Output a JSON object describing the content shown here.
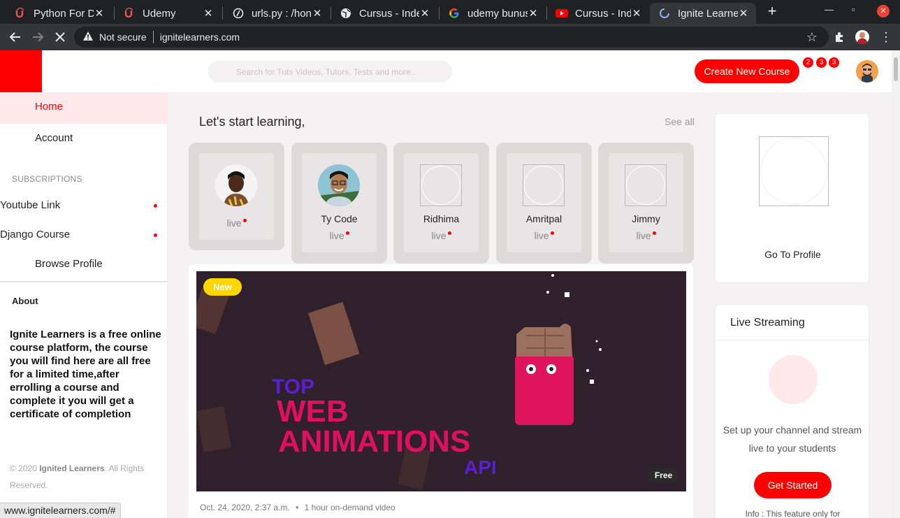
{
  "browser": {
    "tabs": [
      {
        "title": "Python For D",
        "icon": "udemy-icon"
      },
      {
        "title": "Udemy",
        "icon": "udemy-icon"
      },
      {
        "title": "urls.py : /hon",
        "icon": "pythonanywhere-icon"
      },
      {
        "title": "Cursus - Inde",
        "icon": "globe-icon"
      },
      {
        "title": "udemy bunus",
        "icon": "google-icon"
      },
      {
        "title": "Cursus - Inde",
        "icon": "youtube-icon"
      },
      {
        "title": "Ignite Learne",
        "icon": "loading-spinner-icon"
      }
    ],
    "address": {
      "security_label": "Not secure",
      "url": "ignitelearners.com"
    },
    "status_url": "www.ignitelearners.com/#"
  },
  "header": {
    "search_placeholder": "Search for Tuts Videos, Tutors, Tests and more..",
    "create_button": "Create New Course",
    "badges": [
      "2",
      "3",
      "3"
    ]
  },
  "sidebar": {
    "home": "Home",
    "account": "Account",
    "subscriptions_title": "SUBSCRIPTIONS",
    "subscriptions": [
      "Youtube Link",
      "Django Course"
    ],
    "browse_profile": "Browse Profile",
    "about_title": "About",
    "about_text": "Ignite Learners is a free online course platform, the course you will find here are all free for a limited time,after errolling a course and complete it you will get a certificate of completion",
    "copyright_prefix": "© 2020 ",
    "copyright_brand": "Ignited Learners",
    "copyright_suffix": ". All Rights Reserved."
  },
  "main": {
    "title": "Let's start learning,",
    "see_all": "See all",
    "tutors": [
      {
        "name": "",
        "status": "live"
      },
      {
        "name": "Ty Code",
        "status": "live"
      },
      {
        "name": "Ridhima",
        "status": "live"
      },
      {
        "name": "Amritpal",
        "status": "live"
      },
      {
        "name": "Jimmy",
        "status": "live"
      }
    ],
    "course": {
      "badge_new": "New",
      "badge_free": "Free",
      "thumbnail_text": [
        "TOP",
        "WEB",
        "ANIMATIONS",
        "API"
      ],
      "date": "Oct. 24, 2020, 2:37 a.m.",
      "separator": "•",
      "duration": "1 hour on-demand video"
    }
  },
  "right": {
    "go_to_profile": "Go To Profile",
    "live_title": "Live Streaming",
    "live_desc": "Set up your channel and stream live to your students",
    "get_started": "Get Started",
    "info": "Info : This feature only for"
  },
  "colors": {
    "brand_red": "#ff0000",
    "active_bg": "#fde9e9",
    "new_badge": "#ffd700"
  }
}
